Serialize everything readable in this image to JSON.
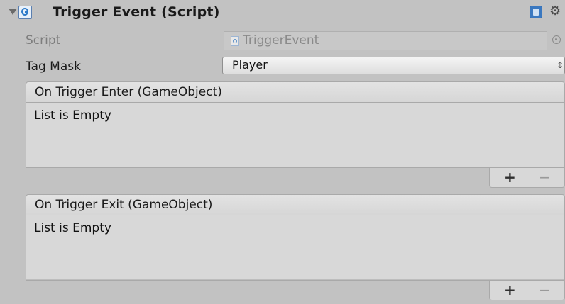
{
  "component": {
    "title": "Trigger Event (Script)",
    "foldout_icon": "triangle-down-icon",
    "enable_icon": "script-checkbox-icon",
    "help_icon": "help-book-icon",
    "settings_icon": "gear-icon"
  },
  "properties": {
    "script": {
      "label": "Script",
      "value": "TriggerEvent",
      "icon": "script-file-icon",
      "picker_icon": "object-picker-icon"
    },
    "tag_mask": {
      "label": "Tag Mask",
      "value": "Player",
      "arrows_icon": "dropdown-arrows-icon"
    }
  },
  "events": [
    {
      "header": "On Trigger Enter (GameObject)",
      "empty_text": "List is Empty",
      "add_label": "+",
      "remove_label": "−"
    },
    {
      "header": "On Trigger Exit (GameObject)",
      "empty_text": "List is Empty",
      "add_label": "+",
      "remove_label": "−"
    }
  ]
}
